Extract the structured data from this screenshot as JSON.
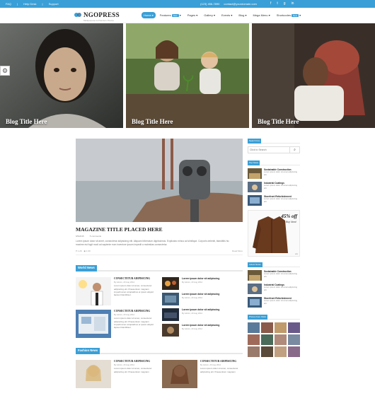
{
  "topbar": {
    "links": [
      "FAQ",
      "Help Desk",
      "Support"
    ],
    "phone": "(123) 456-7890",
    "email": "contact@yourdomain.com",
    "social_icons": [
      "facebook-icon",
      "twitter-icon",
      "google-plus-icon",
      "linkedin-icon"
    ]
  },
  "header": {
    "logo": "NGOPRESS",
    "tagline": "Multipurpose & Premium Theme"
  },
  "nav": [
    {
      "label": "Home",
      "badge": ""
    },
    {
      "label": "Features",
      "badge": "New"
    },
    {
      "label": "Pages",
      "badge": ""
    },
    {
      "label": "Gallery",
      "badge": ""
    },
    {
      "label": "Events",
      "badge": ""
    },
    {
      "label": "Blog",
      "badge": ""
    },
    {
      "label": "Mega Menu",
      "badge": ""
    },
    {
      "label": "Shortcodes",
      "badge": "New"
    }
  ],
  "hero": [
    {
      "caption": "Blog Title Here"
    },
    {
      "caption": "Blog Title Here"
    },
    {
      "caption": "Blog Title Here"
    }
  ],
  "featured": {
    "title": "MAGAZINE TITLE PLACED HERE",
    "date": "6/9/2015",
    "comments": "5 comments",
    "excerpt": "Lorem ipsum dolor sit amet, consectetur adipisicing elit. Aliquam bibendum dignissimos. Explicabo minus ad similique. Corporis deleniti, blanditiis hic maxime est fugit modi ad sapiente eum inventore ipsum impedit a molestias consectetur.",
    "likes": "1.2K",
    "views": "1.0K",
    "read_more": "Read More"
  },
  "world_news": {
    "title": "World News",
    "big": [
      {
        "title": "CONSECTETUR ADIPISICING",
        "meta": "By Admin, 20 Aug 2012",
        "text": "Lorem ipsum dolor sit amet, consectetur adipisicing elit. Praesentium magnam impedit amet voluptatibus et ipsam aliquid lapsus blanditiiser."
      },
      {
        "title": "CONSECTETUR ADIPISICING",
        "meta": "By Admin, 20 Aug 2012",
        "text": "Lorem ipsum dolor sit amet, consectetur adipisicing elit. Praesentium magnam impedit amet voluptatibus et ipsam aliquid lapsus blanditiiser."
      }
    ],
    "small": [
      {
        "title": "Lorem ipsum dolor sit adipiscing",
        "meta": "By Admin, 20 Aug 2012"
      },
      {
        "title": "Lorem ipsum dolor sit adipiscing",
        "meta": "By Admin, 20 Aug 2012"
      },
      {
        "title": "Lorem ipsum dolor sit adipiscing",
        "meta": "By Admin, 20 Aug 2012"
      },
      {
        "title": "Lorem ipsum dolor sit adipiscing",
        "meta": "By Admin, 20 Aug 2012"
      }
    ]
  },
  "fashion_news": {
    "title": "Fashion News",
    "items": [
      {
        "title": "CONSECTETUR ADIPISICING",
        "meta": "By Admin, 20 Aug 2012",
        "text": "Lorem ipsum dolor sit amet, consectetur adipisicing elit. Praesentium magnam"
      },
      {
        "title": "CONSECTETUR ADIPISICING",
        "meta": "By Admin, 20 Aug 2012",
        "text": "Lorem ipsum dolor sit amet, consectetur adipisicing elit. Praesentium magnam"
      }
    ]
  },
  "sidebar": {
    "search_title": "Search box",
    "search_placeholder": "Click to Search",
    "top_news_title": "Top News",
    "top_news": [
      {
        "title": "Sustainable Construction",
        "text": "Lorem ipsum dolor sit amet adipiscing elit."
      },
      {
        "title": "Industrial Coatings",
        "text": "Lorem ipsum dolor sit amet adipiscing elit."
      },
      {
        "title": "Storefront Refurbishment",
        "text": "Lorem ipsum dolor sit amet adipiscing elit."
      }
    ],
    "ad": {
      "offer": "45% off",
      "cta": "Buy Now!",
      "tag": "ads"
    },
    "latest_title": "Latest News",
    "latest_news": [
      {
        "title": "Sustainable Construction",
        "text": "Lorem ipsum dolor sit amet adipiscing elit."
      },
      {
        "title": "Industrial Coatings",
        "text": "Lorem ipsum dolor sit amet adipiscing elit."
      },
      {
        "title": "Storefront Refurbishment",
        "text": "Lorem ipsum dolor sit amet adipiscing elit."
      }
    ],
    "photos_title": "Photos from Flickr"
  },
  "colors": {
    "accent": "#3a9fd6"
  }
}
